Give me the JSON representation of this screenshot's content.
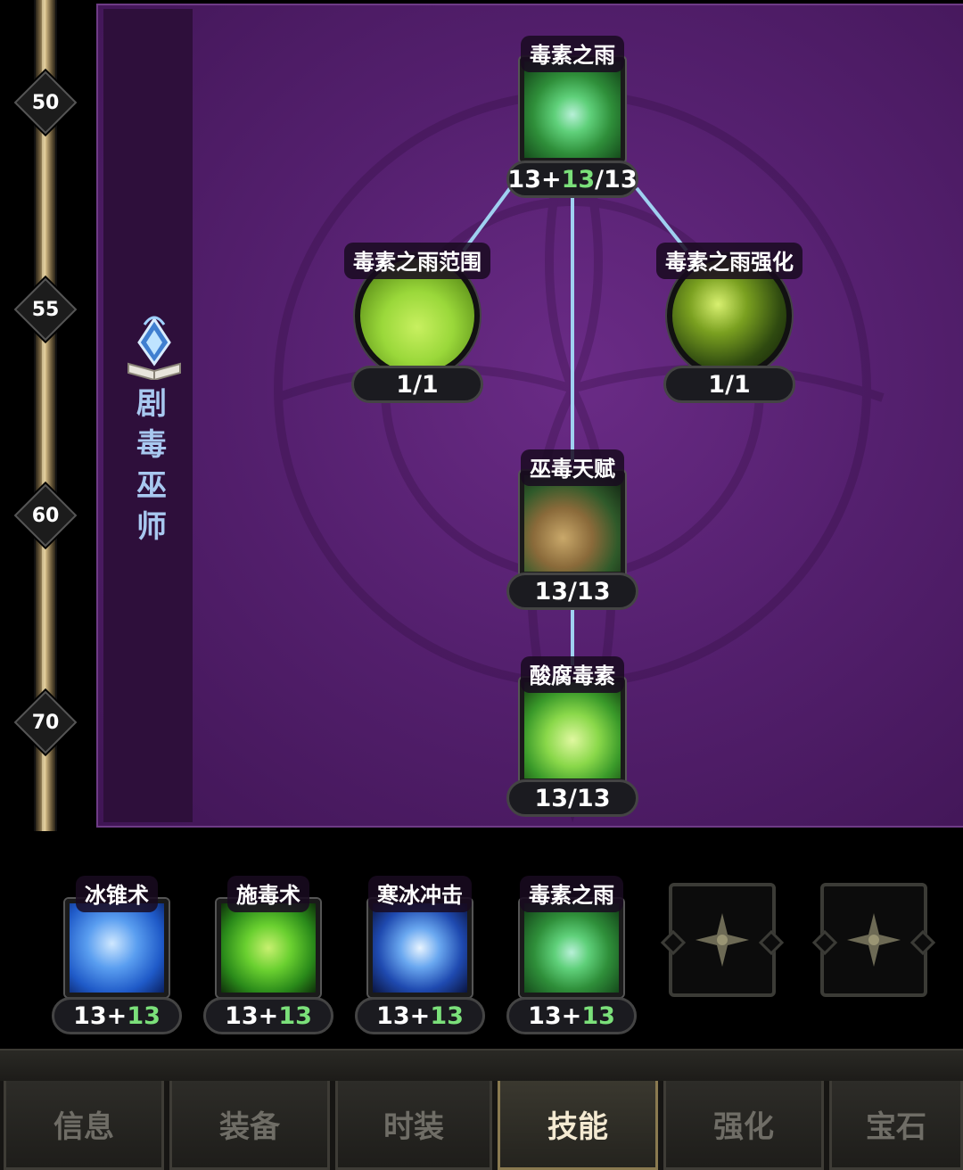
{
  "levels": [
    "50",
    "55",
    "60",
    "70"
  ],
  "class_name": "剧毒巫师",
  "tree": {
    "rain": {
      "label": "毒素之雨",
      "base": "13+",
      "bonus": "13",
      "max": "/13"
    },
    "rain_range": {
      "label": "毒素之雨范围",
      "count": "1/1"
    },
    "rain_boost": {
      "label": "毒素之雨强化",
      "count": "1/1"
    },
    "talent": {
      "label": "巫毒天赋",
      "count": "13/13"
    },
    "acid": {
      "label": "酸腐毒素",
      "count": "13/13"
    }
  },
  "hotbar": [
    {
      "label": "冰锥术",
      "base": "13+",
      "bonus": "13"
    },
    {
      "label": "施毒术",
      "base": "13+",
      "bonus": "13"
    },
    {
      "label": "寒冰冲击",
      "base": "13+",
      "bonus": "13"
    },
    {
      "label": "毒素之雨",
      "base": "13+",
      "bonus": "13"
    }
  ],
  "empty_slot_icon": "cross-plus-icon",
  "tabs": [
    "信息",
    "装备",
    "时装",
    "技能",
    "强化",
    "宝石"
  ],
  "active_tab": "技能",
  "colors": {
    "panel": "#55206f",
    "link": "#9fd0f0",
    "bonus": "#7be07a",
    "active_tab": "#f4ead2"
  }
}
